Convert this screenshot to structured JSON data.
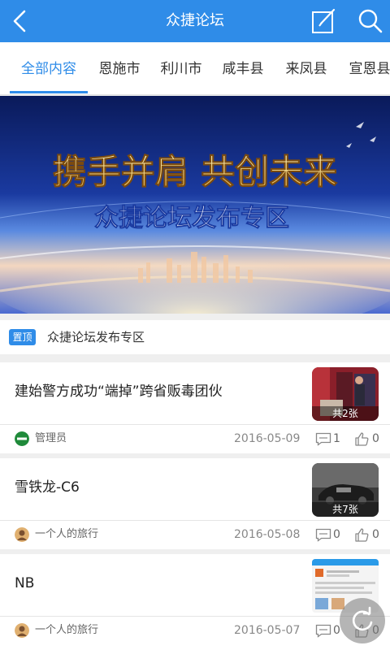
{
  "header": {
    "title": "众捷论坛",
    "back_icon": "back-arrow-icon",
    "edit_icon": "edit-icon",
    "search_icon": "search-icon",
    "background": "#2f8ce8"
  },
  "tabs": [
    {
      "label": "全部内容",
      "active": true
    },
    {
      "label": "恩施市"
    },
    {
      "label": "利川市"
    },
    {
      "label": "咸丰县"
    },
    {
      "label": "来凤县"
    },
    {
      "label": "宣恩县"
    }
  ],
  "banner": {
    "headline": "携手并肩 共创未来",
    "subtitle": "众捷论坛发布专区"
  },
  "pinned": {
    "badge": "置顶",
    "text": "众捷论坛发布专区"
  },
  "posts": [
    {
      "title": "建始警方成功“端掉”跨省贩毒团伙",
      "thumb_count": "共2张",
      "author": "管理员",
      "date": "2016-05-09",
      "comments": "1",
      "likes": "0"
    },
    {
      "title": "雪铁龙-C6",
      "thumb_count": "共7张",
      "author": "一个人的旅行",
      "date": "2016-05-08",
      "comments": "0",
      "likes": "0"
    },
    {
      "title": "NB",
      "author": "一个人的旅行",
      "date": "2016-05-07",
      "comments": "0",
      "likes": "0"
    }
  ],
  "accent_color": "#2f8ce8"
}
